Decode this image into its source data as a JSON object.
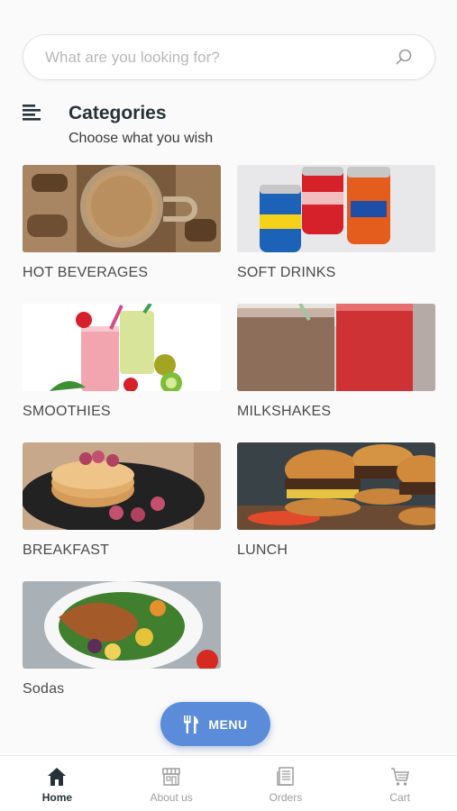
{
  "search": {
    "placeholder": "What are you looking for?",
    "icon": "search-icon"
  },
  "header": {
    "title": "Categories",
    "subtitle": "Choose what you wish",
    "icon": "list-icon"
  },
  "categories": [
    {
      "label": "HOT BEVERAGES"
    },
    {
      "label": "SOFT DRINKS"
    },
    {
      "label": "SMOOTHIES"
    },
    {
      "label": "MILKSHAKES"
    },
    {
      "label": "BREAKFAST"
    },
    {
      "label": "LUNCH"
    },
    {
      "label": "Sodas"
    }
  ],
  "fab": {
    "label": "MENU",
    "icon": "utensils-icon"
  },
  "nav": {
    "items": [
      {
        "label": "Home",
        "icon": "home-icon",
        "active": true
      },
      {
        "label": "About us",
        "icon": "store-icon",
        "active": false
      },
      {
        "label": "Orders",
        "icon": "receipt-icon",
        "active": false
      },
      {
        "label": "Cart",
        "icon": "cart-icon",
        "active": false
      }
    ]
  },
  "colors": {
    "accent": "#5b8cd9",
    "title": "#263238",
    "background": "#fafafa"
  }
}
